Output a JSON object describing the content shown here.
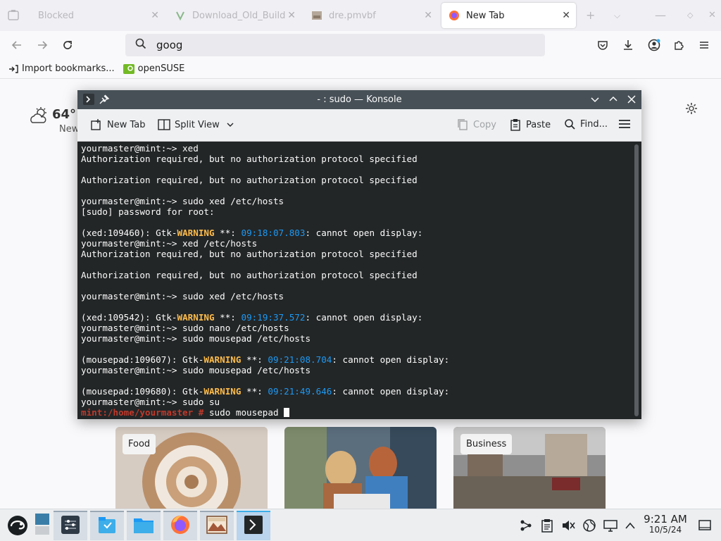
{
  "browser": {
    "tabs": [
      {
        "title": "Blocked",
        "icon": "blocked-icon"
      },
      {
        "title": "Download_Old_Build",
        "icon": "sourceforge-icon"
      },
      {
        "title": "dre.pmvbf",
        "icon": "image-icon"
      },
      {
        "title": "New Tab",
        "icon": "firefox-icon",
        "active": true
      }
    ],
    "url_value": "goog",
    "bookmarks": [
      "Import bookmarks...",
      "openSUSE"
    ]
  },
  "newtab": {
    "weather_temp": "64°",
    "weather_sub": "New",
    "cards": [
      "Food",
      "",
      "Business"
    ]
  },
  "konsole": {
    "title": "- : sudo — Konsole",
    "toolbar": {
      "new_tab": "New Tab",
      "split_view": "Split View",
      "copy": "Copy",
      "paste": "Paste",
      "find": "Find..."
    },
    "lines": [
      "yourmaster@mint:~> xed",
      "Authorization required, but no authorization protocol specified",
      "",
      "Authorization required, but no authorization protocol specified",
      "",
      "yourmaster@mint:~> sudo xed /etc/hosts",
      "[sudo] password for root:",
      "",
      {
        "pre": "(xed:109460): Gtk-",
        "warn": "WARNING",
        "mid": " **: ",
        "ts": "09:18:07.803",
        "post": ": cannot open display:"
      },
      "yourmaster@mint:~> xed /etc/hosts",
      "Authorization required, but no authorization protocol specified",
      "",
      "Authorization required, but no authorization protocol specified",
      "",
      "yourmaster@mint:~> sudo xed /etc/hosts",
      "",
      {
        "pre": "(xed:109542): Gtk-",
        "warn": "WARNING",
        "mid": " **: ",
        "ts": "09:19:37.572",
        "post": ": cannot open display:"
      },
      "yourmaster@mint:~> sudo nano /etc/hosts",
      "yourmaster@mint:~> sudo mousepad /etc/hosts",
      "",
      {
        "pre": "(mousepad:109607): Gtk-",
        "warn": "WARNING",
        "mid": " **: ",
        "ts": "09:21:08.704",
        "post": ": cannot open display:"
      },
      "yourmaster@mint:~> sudo mousepad /etc/hosts",
      "",
      {
        "pre": "(mousepad:109680): Gtk-",
        "warn": "WARNING",
        "mid": " **: ",
        "ts": "09:21:49.646",
        "post": ": cannot open display:"
      },
      "yourmaster@mint:~> sudo su"
    ],
    "root_prompt": "mint:/home/yourmaster #",
    "root_command": " sudo mousepad "
  },
  "taskbar": {
    "time": "9:21 AM",
    "date": "10/5/24",
    "apps": [
      "settings-icon",
      "discover-icon",
      "files-icon",
      "firefox-icon",
      "image-viewer-icon",
      "konsole-icon"
    ]
  },
  "colors": {
    "terminal_bg": "#232627",
    "warning": "#fdbc4b",
    "timestamp": "#1d99f3",
    "root_prompt": "#c0392b",
    "titlebar": "#475057"
  }
}
